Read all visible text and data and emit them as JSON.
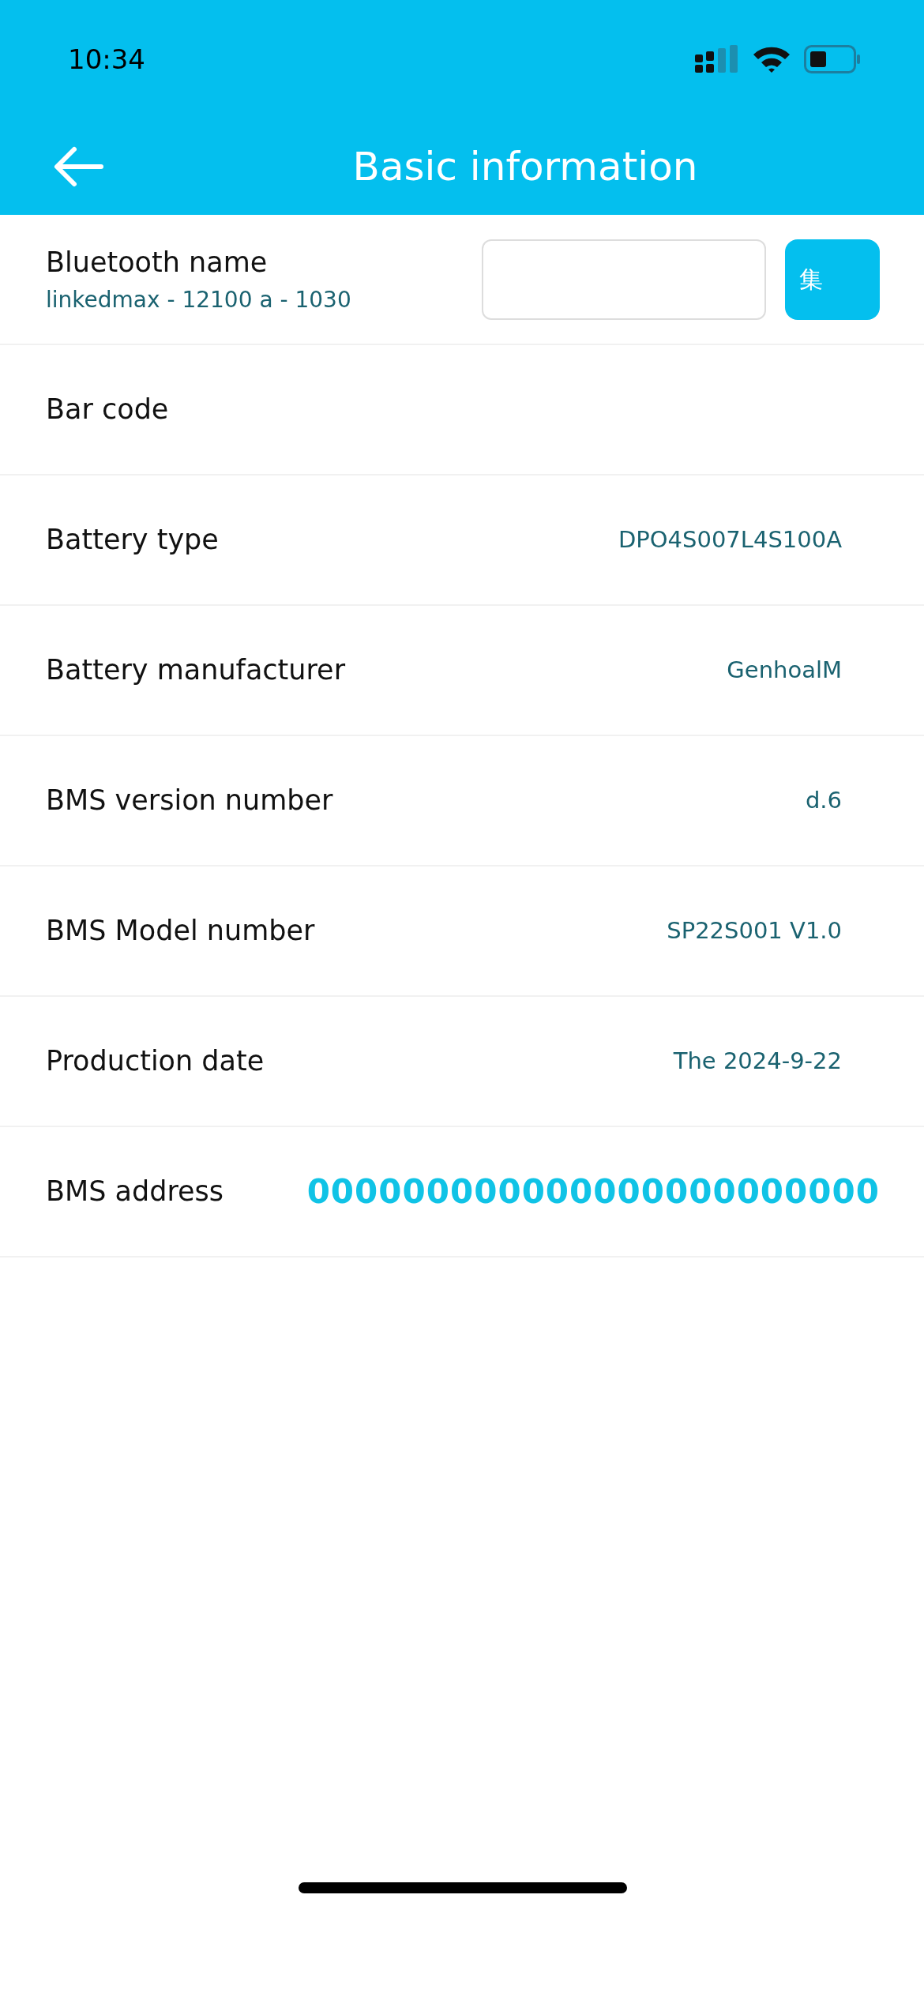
{
  "status_bar": {
    "time": "10:34"
  },
  "header": {
    "title": "Basic information"
  },
  "bluetooth": {
    "label": "Bluetooth name",
    "value": "linkedmax - 12100 a - 1030",
    "button": "集"
  },
  "rows": [
    {
      "label": "Bar code",
      "kind": "plain"
    },
    {
      "label": "Battery type",
      "value": "DPO4S007L4S100A",
      "kind": "plain"
    },
    {
      "label": "Battery manufacturer",
      "value": "GenhoalM",
      "kind": "plain"
    },
    {
      "label": "BMS version number",
      "value": "d.6",
      "kind": "plain"
    },
    {
      "label": "BMS Model number",
      "value": "SP22S001 V1.0",
      "kind": "plain"
    },
    {
      "label": "Production date",
      "value": "The 2024-9-22",
      "kind": "plain"
    },
    {
      "label": "BMS address",
      "value": "000000000000000000000000",
      "kind": "highlight"
    }
  ]
}
